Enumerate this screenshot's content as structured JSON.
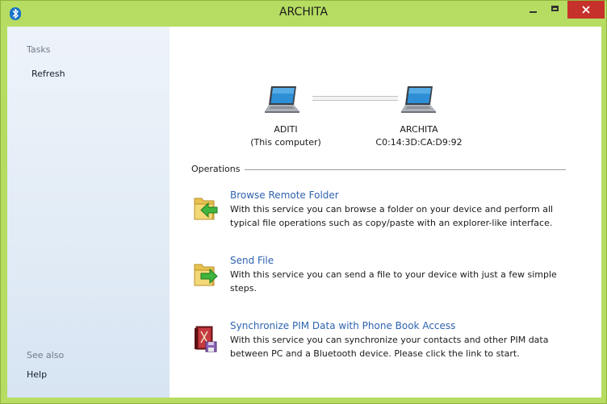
{
  "window": {
    "title": "ARCHITA"
  },
  "sidebar": {
    "tasks_header": "Tasks",
    "refresh_label": "Refresh",
    "see_also_header": "See also",
    "help_label": "Help"
  },
  "devices": {
    "local": {
      "name": "ADITI",
      "detail": "(This computer)"
    },
    "remote": {
      "name": "ARCHITA",
      "detail": "C0:14:3D:CA:D9:92"
    }
  },
  "operations": {
    "header": "Operations",
    "items": [
      {
        "title": "Browse Remote Folder",
        "description": "With this service you can browse a folder on your device and perform all typical file operations such as copy/paste with an explorer-like interface.",
        "icon": "folder-arrow-left-icon"
      },
      {
        "title": "Send File",
        "description": "With this service you can send a file to your device with just a few simple steps.",
        "icon": "folder-arrow-right-icon"
      },
      {
        "title": "Synchronize PIM Data with Phone Book Access",
        "description": "With this service you can synchronize your contacts and other PIM data between PC and a Bluetooth device. Please click the link to start.",
        "icon": "phonebook-sync-icon"
      }
    ]
  },
  "colors": {
    "frame": "#b6dd62",
    "close": "#c7312b",
    "link": "#2f63b0",
    "bluetooth": "#1773c9"
  }
}
